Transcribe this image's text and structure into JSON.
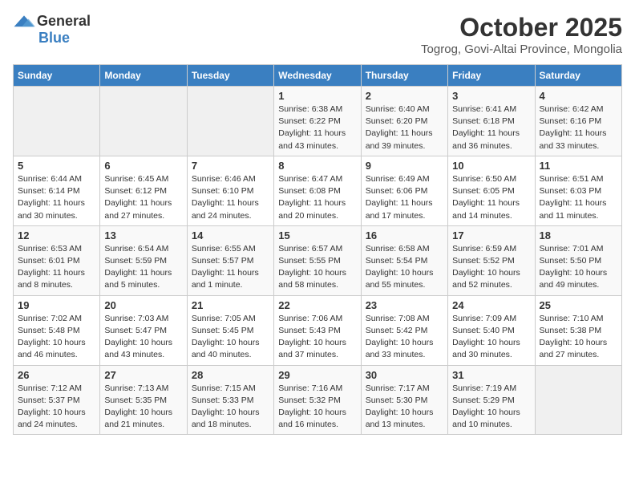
{
  "logo": {
    "general": "General",
    "blue": "Blue"
  },
  "header": {
    "month": "October 2025",
    "location": "Togrog, Govi-Altai Province, Mongolia"
  },
  "days_of_week": [
    "Sunday",
    "Monday",
    "Tuesday",
    "Wednesday",
    "Thursday",
    "Friday",
    "Saturday"
  ],
  "weeks": [
    [
      {
        "day": "",
        "info": ""
      },
      {
        "day": "",
        "info": ""
      },
      {
        "day": "",
        "info": ""
      },
      {
        "day": "1",
        "info": "Sunrise: 6:38 AM\nSunset: 6:22 PM\nDaylight: 11 hours\nand 43 minutes."
      },
      {
        "day": "2",
        "info": "Sunrise: 6:40 AM\nSunset: 6:20 PM\nDaylight: 11 hours\nand 39 minutes."
      },
      {
        "day": "3",
        "info": "Sunrise: 6:41 AM\nSunset: 6:18 PM\nDaylight: 11 hours\nand 36 minutes."
      },
      {
        "day": "4",
        "info": "Sunrise: 6:42 AM\nSunset: 6:16 PM\nDaylight: 11 hours\nand 33 minutes."
      }
    ],
    [
      {
        "day": "5",
        "info": "Sunrise: 6:44 AM\nSunset: 6:14 PM\nDaylight: 11 hours\nand 30 minutes."
      },
      {
        "day": "6",
        "info": "Sunrise: 6:45 AM\nSunset: 6:12 PM\nDaylight: 11 hours\nand 27 minutes."
      },
      {
        "day": "7",
        "info": "Sunrise: 6:46 AM\nSunset: 6:10 PM\nDaylight: 11 hours\nand 24 minutes."
      },
      {
        "day": "8",
        "info": "Sunrise: 6:47 AM\nSunset: 6:08 PM\nDaylight: 11 hours\nand 20 minutes."
      },
      {
        "day": "9",
        "info": "Sunrise: 6:49 AM\nSunset: 6:06 PM\nDaylight: 11 hours\nand 17 minutes."
      },
      {
        "day": "10",
        "info": "Sunrise: 6:50 AM\nSunset: 6:05 PM\nDaylight: 11 hours\nand 14 minutes."
      },
      {
        "day": "11",
        "info": "Sunrise: 6:51 AM\nSunset: 6:03 PM\nDaylight: 11 hours\nand 11 minutes."
      }
    ],
    [
      {
        "day": "12",
        "info": "Sunrise: 6:53 AM\nSunset: 6:01 PM\nDaylight: 11 hours\nand 8 minutes."
      },
      {
        "day": "13",
        "info": "Sunrise: 6:54 AM\nSunset: 5:59 PM\nDaylight: 11 hours\nand 5 minutes."
      },
      {
        "day": "14",
        "info": "Sunrise: 6:55 AM\nSunset: 5:57 PM\nDaylight: 11 hours\nand 1 minute."
      },
      {
        "day": "15",
        "info": "Sunrise: 6:57 AM\nSunset: 5:55 PM\nDaylight: 10 hours\nand 58 minutes."
      },
      {
        "day": "16",
        "info": "Sunrise: 6:58 AM\nSunset: 5:54 PM\nDaylight: 10 hours\nand 55 minutes."
      },
      {
        "day": "17",
        "info": "Sunrise: 6:59 AM\nSunset: 5:52 PM\nDaylight: 10 hours\nand 52 minutes."
      },
      {
        "day": "18",
        "info": "Sunrise: 7:01 AM\nSunset: 5:50 PM\nDaylight: 10 hours\nand 49 minutes."
      }
    ],
    [
      {
        "day": "19",
        "info": "Sunrise: 7:02 AM\nSunset: 5:48 PM\nDaylight: 10 hours\nand 46 minutes."
      },
      {
        "day": "20",
        "info": "Sunrise: 7:03 AM\nSunset: 5:47 PM\nDaylight: 10 hours\nand 43 minutes."
      },
      {
        "day": "21",
        "info": "Sunrise: 7:05 AM\nSunset: 5:45 PM\nDaylight: 10 hours\nand 40 minutes."
      },
      {
        "day": "22",
        "info": "Sunrise: 7:06 AM\nSunset: 5:43 PM\nDaylight: 10 hours\nand 37 minutes."
      },
      {
        "day": "23",
        "info": "Sunrise: 7:08 AM\nSunset: 5:42 PM\nDaylight: 10 hours\nand 33 minutes."
      },
      {
        "day": "24",
        "info": "Sunrise: 7:09 AM\nSunset: 5:40 PM\nDaylight: 10 hours\nand 30 minutes."
      },
      {
        "day": "25",
        "info": "Sunrise: 7:10 AM\nSunset: 5:38 PM\nDaylight: 10 hours\nand 27 minutes."
      }
    ],
    [
      {
        "day": "26",
        "info": "Sunrise: 7:12 AM\nSunset: 5:37 PM\nDaylight: 10 hours\nand 24 minutes."
      },
      {
        "day": "27",
        "info": "Sunrise: 7:13 AM\nSunset: 5:35 PM\nDaylight: 10 hours\nand 21 minutes."
      },
      {
        "day": "28",
        "info": "Sunrise: 7:15 AM\nSunset: 5:33 PM\nDaylight: 10 hours\nand 18 minutes."
      },
      {
        "day": "29",
        "info": "Sunrise: 7:16 AM\nSunset: 5:32 PM\nDaylight: 10 hours\nand 16 minutes."
      },
      {
        "day": "30",
        "info": "Sunrise: 7:17 AM\nSunset: 5:30 PM\nDaylight: 10 hours\nand 13 minutes."
      },
      {
        "day": "31",
        "info": "Sunrise: 7:19 AM\nSunset: 5:29 PM\nDaylight: 10 hours\nand 10 minutes."
      },
      {
        "day": "",
        "info": ""
      }
    ]
  ]
}
